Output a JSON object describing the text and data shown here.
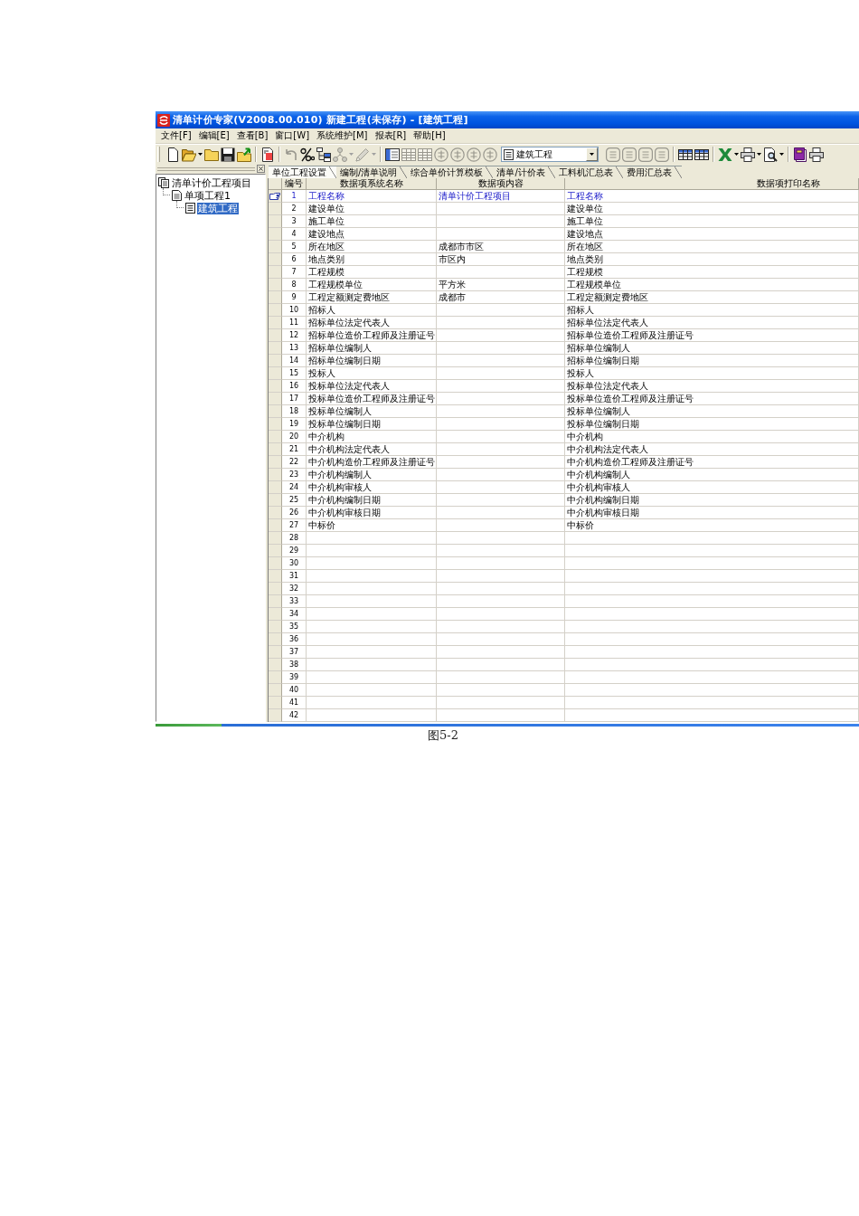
{
  "window": {
    "title": "清单计价专家(V2008.00.010) 新建工程(未保存) - [建筑工程]"
  },
  "menu": [
    "文件[F]",
    "编辑[E]",
    "查看[B]",
    "窗口[W]",
    "系统维护[M]",
    "报表[R]",
    "帮助[H]"
  ],
  "toolbar": {
    "groups": [
      {
        "items": [
          {
            "kind": "page",
            "disabled": false,
            "dropdown": false
          },
          {
            "kind": "open",
            "disabled": false,
            "dropdown": true
          },
          {
            "kind": "folder",
            "disabled": false,
            "dropdown": false
          },
          {
            "kind": "save",
            "disabled": false,
            "dropdown": false
          },
          {
            "kind": "export",
            "disabled": false,
            "dropdown": false
          }
        ]
      },
      {
        "items": [
          {
            "kind": "document",
            "disabled": false,
            "dropdown": false
          }
        ]
      },
      {
        "items": [
          {
            "kind": "undo",
            "disabled": true,
            "dropdown": false
          },
          {
            "kind": "percent",
            "disabled": false,
            "dropdown": false
          },
          {
            "kind": "tree",
            "disabled": false,
            "dropdown": false
          },
          {
            "kind": "network",
            "disabled": true,
            "dropdown": true
          },
          {
            "kind": "pencil",
            "disabled": true,
            "dropdown": true
          }
        ]
      },
      {
        "items": [
          {
            "kind": "panel",
            "disabled": false,
            "dropdown": false
          },
          {
            "kind": "grid",
            "disabled": true,
            "dropdown": false
          },
          {
            "kind": "grid",
            "disabled": true,
            "dropdown": false
          },
          {
            "kind": "circle",
            "disabled": true,
            "dropdown": false
          },
          {
            "kind": "circle",
            "disabled": true,
            "dropdown": false
          },
          {
            "kind": "circle",
            "disabled": true,
            "dropdown": false
          },
          {
            "kind": "circle",
            "disabled": true,
            "dropdown": false
          },
          {
            "kind": "combo",
            "value": "建筑工程",
            "disabled": false,
            "dropdown": true
          },
          {
            "kind": "square",
            "disabled": true,
            "dropdown": false
          },
          {
            "kind": "square",
            "disabled": true,
            "dropdown": false
          },
          {
            "kind": "square",
            "disabled": true,
            "dropdown": false
          },
          {
            "kind": "square",
            "disabled": true,
            "dropdown": false
          }
        ]
      },
      {
        "items": [
          {
            "kind": "table",
            "disabled": false,
            "dropdown": false
          },
          {
            "kind": "table",
            "disabled": false,
            "dropdown": false
          }
        ]
      },
      {
        "items": [
          {
            "kind": "excel",
            "disabled": false,
            "dropdown": true
          },
          {
            "kind": "printer",
            "disabled": false,
            "dropdown": true
          },
          {
            "kind": "preview",
            "disabled": false,
            "dropdown": true
          }
        ]
      },
      {
        "items": [
          {
            "kind": "book",
            "disabled": false,
            "dropdown": false
          },
          {
            "kind": "printer",
            "disabled": false,
            "dropdown": false
          }
        ]
      }
    ]
  },
  "tree": {
    "items": [
      {
        "label": "清单计价工程项目",
        "kind": "project",
        "selected": false,
        "children": [
          {
            "label": "单项工程1",
            "kind": "item",
            "selected": false,
            "children": [
              {
                "label": "建筑工程",
                "kind": "unit",
                "selected": true
              }
            ]
          }
        ]
      }
    ]
  },
  "tabs": [
    {
      "label": "单位工程设置",
      "selected": true
    },
    {
      "label": "编制/清单说明",
      "selected": false
    },
    {
      "label": "综合单价计算模板",
      "selected": false
    },
    {
      "label": "清单/计价表",
      "selected": false
    },
    {
      "label": "工料机汇总表",
      "selected": false
    },
    {
      "label": "费用汇总表",
      "selected": false
    }
  ],
  "table": {
    "columns": [
      "编号",
      "数据项系统名称",
      "数据项内容",
      "数据项打印名称"
    ],
    "rows": [
      {
        "number": "1",
        "system_name": "工程名称",
        "content": "清单计价工程项目",
        "print_name": "工程名称",
        "selected": true
      },
      {
        "number": "2",
        "system_name": "建设单位",
        "print_name": "建设单位",
        "selected": false
      },
      {
        "number": "3",
        "system_name": "施工单位",
        "print_name": "施工单位",
        "selected": false
      },
      {
        "number": "4",
        "system_name": "建设地点",
        "print_name": "建设地点",
        "selected": false
      },
      {
        "number": "5",
        "system_name": "所在地区",
        "content": "成都市市区",
        "print_name": "所在地区",
        "selected": false
      },
      {
        "number": "6",
        "system_name": "地点类别",
        "content": "市区内",
        "print_name": "地点类别",
        "selected": false
      },
      {
        "number": "7",
        "system_name": "工程规模",
        "print_name": "工程规模",
        "selected": false
      },
      {
        "number": "8",
        "system_name": "工程规模单位",
        "content": "平方米",
        "print_name": "工程规模单位",
        "selected": false
      },
      {
        "number": "9",
        "system_name": "工程定额测定费地区",
        "content": "成都市",
        "print_name": "工程定额测定费地区",
        "selected": false
      },
      {
        "number": "10",
        "system_name": "招标人",
        "print_name": "招标人",
        "selected": false
      },
      {
        "number": "11",
        "system_name": "招标单位法定代表人",
        "print_name": "招标单位法定代表人",
        "selected": false
      },
      {
        "number": "12",
        "system_name": "招标单位造价工程师及注册证号",
        "print_name": "招标单位造价工程师及注册证号",
        "selected": false
      },
      {
        "number": "13",
        "system_name": "招标单位编制人",
        "print_name": "招标单位编制人",
        "selected": false
      },
      {
        "number": "14",
        "system_name": "招标单位编制日期",
        "print_name": "招标单位编制日期",
        "selected": false
      },
      {
        "number": "15",
        "system_name": "投标人",
        "print_name": "投标人",
        "selected": false
      },
      {
        "number": "16",
        "system_name": "投标单位法定代表人",
        "print_name": "投标单位法定代表人",
        "selected": false
      },
      {
        "number": "17",
        "system_name": "投标单位造价工程师及注册证号",
        "print_name": "投标单位造价工程师及注册证号",
        "selected": false
      },
      {
        "number": "18",
        "system_name": "投标单位编制人",
        "print_name": "投标单位编制人",
        "selected": false
      },
      {
        "number": "19",
        "system_name": "投标单位编制日期",
        "print_name": "投标单位编制日期",
        "selected": false
      },
      {
        "number": "20",
        "system_name": "中介机构",
        "print_name": "中介机构",
        "selected": false
      },
      {
        "number": "21",
        "system_name": "中介机构法定代表人",
        "print_name": "中介机构法定代表人",
        "selected": false
      },
      {
        "number": "22",
        "system_name": "中介机构造价工程师及注册证号",
        "print_name": "中介机构造价工程师及注册证号",
        "selected": false
      },
      {
        "number": "23",
        "system_name": "中介机构编制人",
        "print_name": "中介机构编制人",
        "selected": false
      },
      {
        "number": "24",
        "system_name": "中介机构审核人",
        "print_name": "中介机构审核人",
        "selected": false
      },
      {
        "number": "25",
        "system_name": "中介机构编制日期",
        "print_name": "中介机构编制日期",
        "selected": false
      },
      {
        "number": "26",
        "system_name": "中介机构审核日期",
        "print_name": "中介机构审核日期",
        "selected": false
      },
      {
        "number": "27",
        "system_name": "中标价",
        "print_name": "中标价",
        "selected": false
      },
      {
        "number": "28",
        "selected": false
      },
      {
        "number": "29",
        "selected": false
      },
      {
        "number": "30",
        "selected": false
      },
      {
        "number": "31",
        "selected": false
      },
      {
        "number": "32",
        "selected": false
      },
      {
        "number": "33",
        "selected": false
      },
      {
        "number": "34",
        "selected": false
      },
      {
        "number": "35",
        "selected": false
      },
      {
        "number": "36",
        "selected": false
      },
      {
        "number": "37",
        "selected": false
      },
      {
        "number": "38",
        "selected": false
      },
      {
        "number": "39",
        "selected": false
      },
      {
        "number": "40",
        "selected": false
      },
      {
        "number": "41",
        "selected": false
      },
      {
        "number": "42",
        "selected": false
      }
    ]
  },
  "caption": "图5-2"
}
